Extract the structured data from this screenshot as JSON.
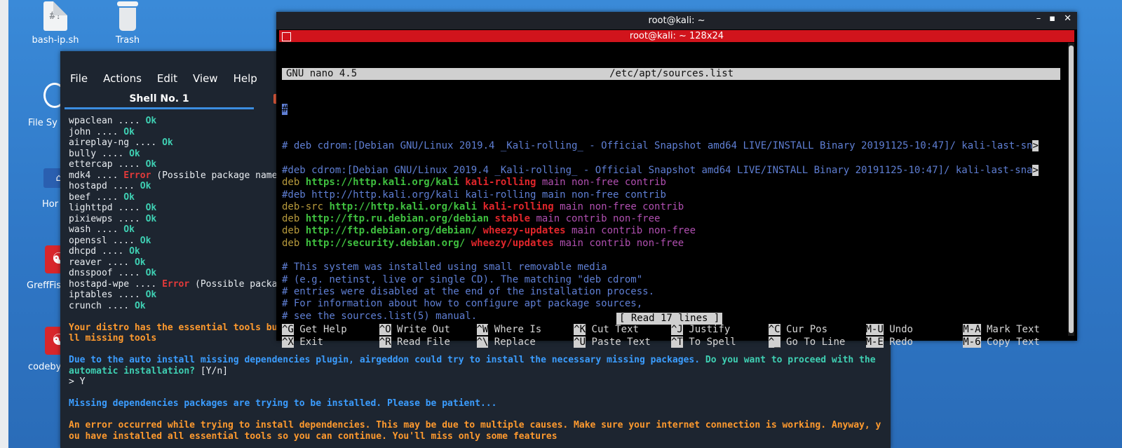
{
  "desktop": {
    "icons": [
      {
        "label": "bash-ip.sh",
        "glyph": "#!"
      },
      {
        "label": "Trash"
      },
      {
        "label": "File Sy"
      },
      {
        "label": "Hor"
      },
      {
        "label": "GreffFis"
      },
      {
        "label": "codeby"
      }
    ]
  },
  "shell_window": {
    "menu": [
      "File",
      "Actions",
      "Edit",
      "View",
      "Help"
    ],
    "tab_label": "Shell No. 1",
    "tab_close": "×",
    "status_lines": [
      {
        "name": "wpaclean",
        "status": "Ok"
      },
      {
        "name": "john",
        "status": "Ok"
      },
      {
        "name": "aireplay-ng",
        "status": "Ok"
      },
      {
        "name": "bully",
        "status": "Ok"
      },
      {
        "name": "ettercap",
        "status": "Ok"
      },
      {
        "name": "mdk4",
        "status": "Error",
        "note": "(Possible package name"
      },
      {
        "name": "hostapd",
        "status": "Ok"
      },
      {
        "name": "beef",
        "status": "Ok"
      },
      {
        "name": "lighttpd",
        "status": "Ok"
      },
      {
        "name": "pixiewps",
        "status": "Ok"
      },
      {
        "name": "wash",
        "status": "Ok"
      },
      {
        "name": "openssl",
        "status": "Ok"
      },
      {
        "name": "dhcpd",
        "status": "Ok"
      },
      {
        "name": "reaver",
        "status": "Ok"
      },
      {
        "name": "dnsspoof",
        "status": "Ok"
      },
      {
        "name": "hostapd-wpe",
        "status": "Error",
        "note": "(Possible packa"
      },
      {
        "name": "iptables",
        "status": "Ok"
      },
      {
        "name": "crunch",
        "status": "Ok"
      }
    ],
    "dots": " .... ",
    "essential_msg_1": "Your distro has the essential tools bu",
    "essential_msg_2": "ll missing tools",
    "auto_install_msg_1": "Due to the auto install missing dependencies plugin, airgeddon could try to install the necessary missing packages.",
    "auto_install_question_1": " Do you want to proceed with the",
    "auto_install_question_2": "automatic installation?",
    "auto_install_choice": " [Y/n]",
    "prompt": "> Y",
    "installing_msg": "Missing dependencies packages are trying to be installed. Please be patient...",
    "error_msg_1": "An error occurred while trying to install dependencies. This may be due to multiple causes. Make sure your internet connection is working. Anyway, y",
    "error_msg_2": "ou have installed all essential tools so you can continue. You'll miss only some features"
  },
  "nano_window": {
    "window_title": "root@kali: ~",
    "session_title": "root@kali: ~ 128x24",
    "controls": [
      "–",
      "▪",
      "✕"
    ],
    "header_left": "GNU nano 4.5",
    "header_center": "/etc/apt/sources.list",
    "cursor_line": "#",
    "cdrom_line_1": "# deb cdrom:[Debian GNU/Linux 2019.4 _Kali-rolling_ - Official Snapshot amd64 LIVE/INSTALL Binary 20191125-10:47]/ kali-last-sn",
    "cdrom_line_2": "#deb cdrom:[Debian GNU/Linux 2019.4 _Kali-rolling_ - Official Snapshot amd64 LIVE/INSTALL Binary 20191125-10:47]/ kali-last-sna",
    "overflow": ">",
    "sources": [
      {
        "type": "deb",
        "url": "https://http.kali.org/kali",
        "dist": "kali-rolling",
        "comp": "main non-free contrib",
        "commented": false
      },
      {
        "type": "#deb",
        "url": "http://http.kali.org/kali",
        "dist": "kali-rolling",
        "comp": "main non-free contrib",
        "commented": true
      },
      {
        "type": "deb-src",
        "url": "http://http.kali.org/kali",
        "dist": "kali-rolling",
        "comp": "main non-free contrib",
        "commented": false
      },
      {
        "type": "deb",
        "url": "http://ftp.ru.debian.org/debian",
        "dist": "stable",
        "comp": "main contrib non-free",
        "commented": false
      },
      {
        "type": "deb",
        "url": "http://ftp.debian.org/debian/",
        "dist": "wheezy-updates",
        "comp": "main contrib non-free",
        "commented": false
      },
      {
        "type": "deb",
        "url": "http://security.debian.org/",
        "dist": "wheezy/updates",
        "comp": "main contrib non-free",
        "commented": false
      }
    ],
    "comments": [
      "# This system was installed using small removable media",
      "# (e.g. netinst, live or single CD). The matching \"deb cdrom\"",
      "# entries were disabled at the end of the installation process.",
      "# For information about how to configure apt package sources,",
      "# see the sources.list(5) manual."
    ],
    "status": "[ Read 17 lines ]",
    "shortcuts_row1": [
      {
        "key": "^G",
        "label": "Get Help"
      },
      {
        "key": "^O",
        "label": "Write Out"
      },
      {
        "key": "^W",
        "label": "Where Is"
      },
      {
        "key": "^K",
        "label": "Cut Text"
      },
      {
        "key": "^J",
        "label": "Justify"
      },
      {
        "key": "^C",
        "label": "Cur Pos"
      },
      {
        "key": "M-U",
        "label": "Undo"
      },
      {
        "key": "M-A",
        "label": "Mark Text"
      }
    ],
    "shortcuts_row2": [
      {
        "key": "^X",
        "label": "Exit"
      },
      {
        "key": "^R",
        "label": "Read File"
      },
      {
        "key": "^\\",
        "label": "Replace"
      },
      {
        "key": "^U",
        "label": "Paste Text"
      },
      {
        "key": "^T",
        "label": "To Spell"
      },
      {
        "key": "^_",
        "label": "Go To Line"
      },
      {
        "key": "M-E",
        "label": "Redo"
      },
      {
        "key": "M-6",
        "label": "Copy Text"
      }
    ]
  }
}
